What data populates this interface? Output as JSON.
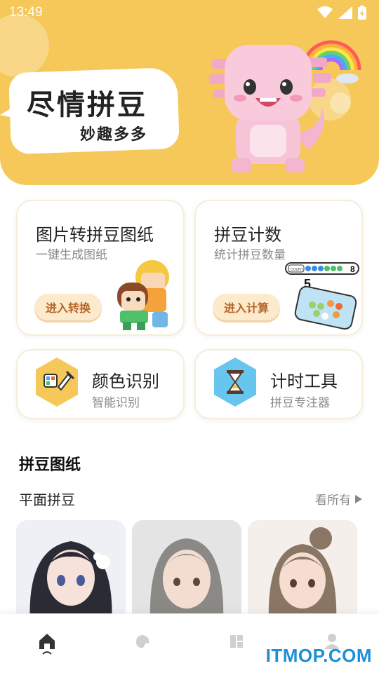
{
  "status": {
    "time": "13:49"
  },
  "hero": {
    "title": "尽情拼豆",
    "subtitle": "妙趣多多"
  },
  "cards": {
    "convert": {
      "title": "图片转拼豆图纸",
      "subtitle": "一键生成图纸",
      "button": "进入转换"
    },
    "count": {
      "title": "拼豆计数",
      "subtitle": "统计拼豆数量",
      "button": "进入计算",
      "counter_label": "COUNT",
      "counter_value": "8",
      "counter_left": "5"
    },
    "color": {
      "title": "颜色识别",
      "subtitle": "智能识别"
    },
    "timer": {
      "title": "计时工具",
      "subtitle": "拼豆专注器"
    }
  },
  "section": {
    "title": "拼豆图纸",
    "subtitle": "平面拼豆",
    "see_all": "看所有"
  },
  "tabs": [
    {
      "icon": "home-icon",
      "active": true
    },
    {
      "icon": "palette-icon",
      "active": false
    },
    {
      "icon": "grid-icon",
      "active": false
    },
    {
      "icon": "user-icon",
      "active": false
    }
  ],
  "watermark": "ITMOP.COM",
  "colors": {
    "brand": "#f6c85a",
    "accent": "#b5672b",
    "tab_active": "#333333",
    "tab_inactive": "#cccccc"
  }
}
